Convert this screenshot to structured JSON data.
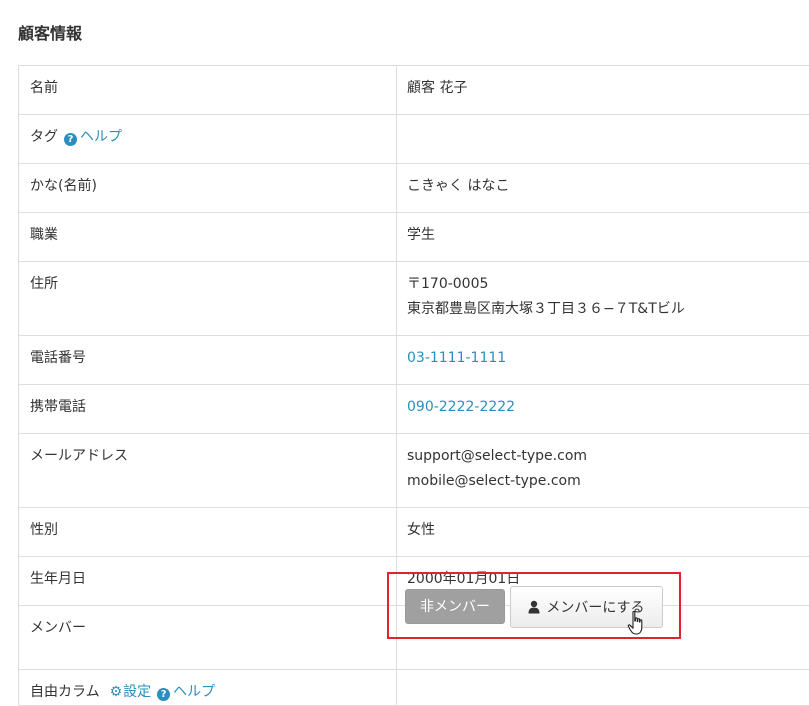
{
  "page": {
    "title": "顧客情報"
  },
  "rows": {
    "name": {
      "label": "名前",
      "value": "顧客 花子"
    },
    "tag": {
      "label": "タグ",
      "help": "ヘルプ"
    },
    "kana": {
      "label": "かな(名前)",
      "value": "こきゃく はなこ"
    },
    "job": {
      "label": "職業",
      "value": "学生"
    },
    "address": {
      "label": "住所",
      "postal": "〒170-0005",
      "line": "東京都豊島区南大塚３丁目３６−７T&Tビル"
    },
    "phone": {
      "label": "電話番号",
      "value": "03-1111-1111"
    },
    "mobile": {
      "label": "携帯電話",
      "value": "090-2222-2222"
    },
    "email": {
      "label": "メールアドレス",
      "values": [
        "support@select-type.com",
        "mobile@select-type.com"
      ]
    },
    "gender": {
      "label": "性別",
      "value": "女性"
    },
    "birthday": {
      "label": "生年月日",
      "value": "2000年01月01日"
    },
    "member": {
      "label": "メンバー",
      "nonmember_button": "非メンバー",
      "become_button": "メンバーにする"
    },
    "free": {
      "label": "自由カラム",
      "settings": "設定",
      "help": "ヘルプ"
    }
  },
  "colors": {
    "link": "#2a8fbd",
    "highlight": "#e0232e",
    "nonmember_bg": "#a0a0a0"
  },
  "icons": {
    "help": "question-circle-icon",
    "settings": "gear-icon",
    "user": "user-icon",
    "cursor": "hand-pointer-icon"
  }
}
